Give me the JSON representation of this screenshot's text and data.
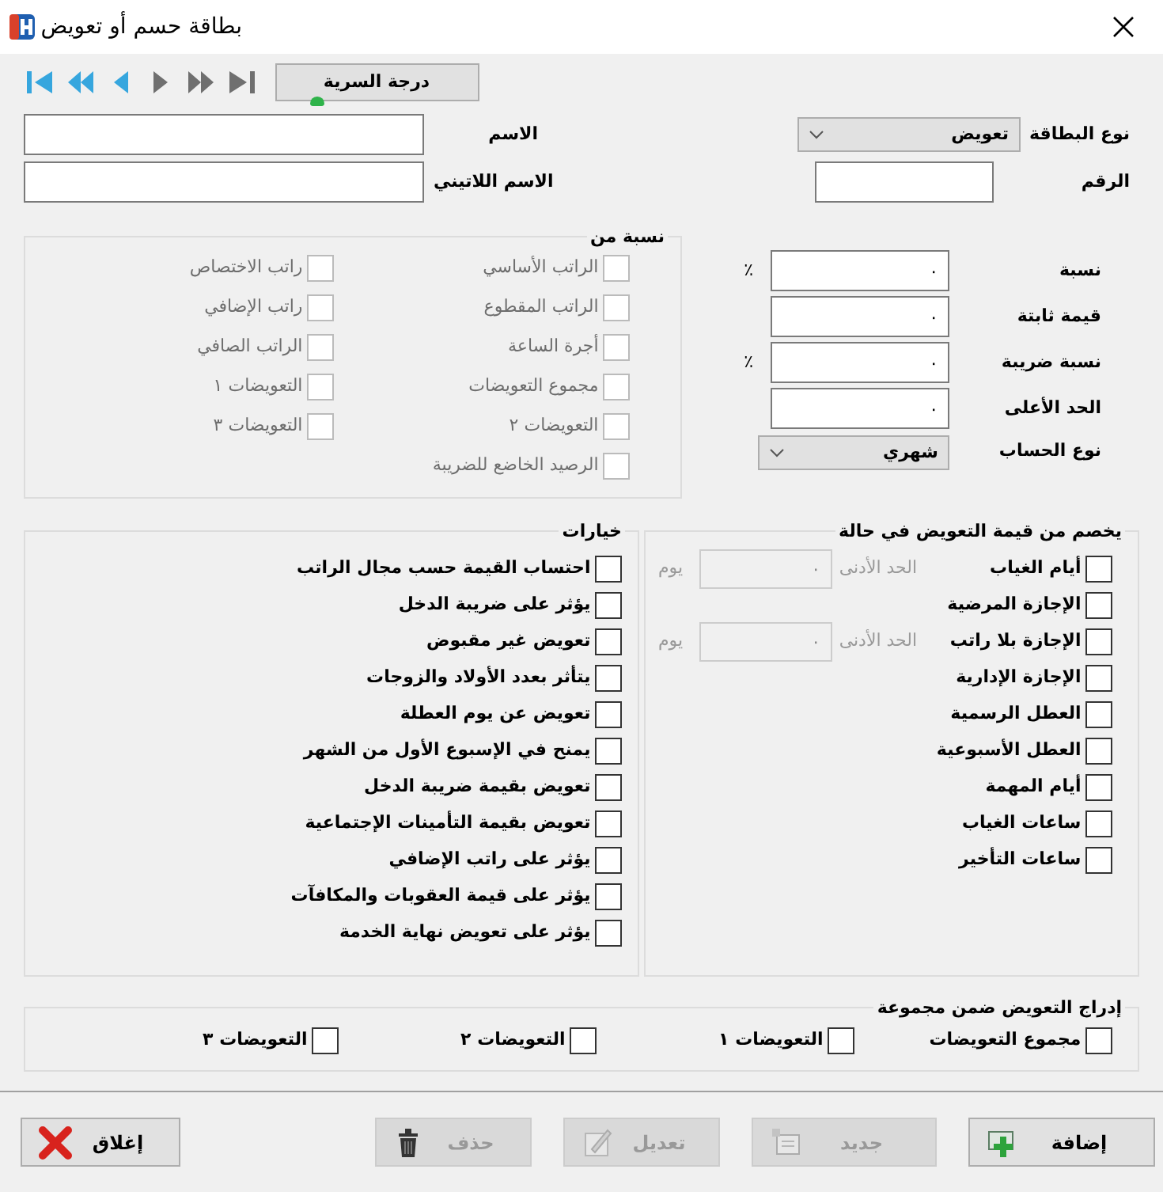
{
  "window": {
    "title": "بطاقة حسم أو تعويض"
  },
  "nav_buttons": [
    {
      "kind": "first",
      "disabled": false
    },
    {
      "kind": "prev-page",
      "disabled": false
    },
    {
      "kind": "prev",
      "disabled": false
    },
    {
      "kind": "next",
      "disabled": true
    },
    {
      "kind": "next-page",
      "disabled": true
    },
    {
      "kind": "last",
      "disabled": true
    }
  ],
  "secrecy_button": {
    "label": "درجة السرية"
  },
  "card_type": {
    "label": "نوع البطاقة",
    "value": "تعويض"
  },
  "number": {
    "label": "الرقم"
  },
  "name": {
    "label": "الاسم"
  },
  "latin_name": {
    "label": "الاسم اللاتيني"
  },
  "amounts": [
    {
      "kind": "field",
      "label": "نسبة",
      "value": "٠",
      "unit": "٪"
    },
    {
      "kind": "field",
      "label": "قيمة ثابتة",
      "value": "٠"
    },
    {
      "kind": "field",
      "label": "نسبة ضريبة",
      "value": "٠",
      "unit": "٪"
    },
    {
      "kind": "field",
      "label": "الحد الأعلى",
      "value": "٠"
    },
    {
      "kind": "select",
      "label": "نوع الحساب",
      "value": "شهري"
    }
  ],
  "percent_of": {
    "title": "نسبة من",
    "columns": [
      [
        {
          "label": "الراتب الأساسي",
          "checked": false,
          "disabled": true
        },
        {
          "label": "الراتب المقطوع",
          "checked": false,
          "disabled": true
        },
        {
          "label": "أجرة الساعة",
          "checked": false,
          "disabled": true
        },
        {
          "label": "مجموع التعويضات",
          "checked": false,
          "disabled": true
        },
        {
          "label": "التعويضات ٢",
          "checked": false,
          "disabled": true
        },
        {
          "label": "الرصيد الخاضع للضريبة",
          "checked": false,
          "disabled": true
        }
      ],
      [
        {
          "label": "راتب الاختصاص",
          "checked": false,
          "disabled": true
        },
        {
          "label": "راتب الإضافي",
          "checked": false,
          "disabled": true
        },
        {
          "label": "الراتب الصافي",
          "checked": false,
          "disabled": true
        },
        {
          "label": "التعويضات ١",
          "checked": false,
          "disabled": true
        },
        {
          "label": "التعويضات ٣",
          "checked": false,
          "disabled": true
        }
      ]
    ]
  },
  "deduct": {
    "title": "يخصم من قيمة التعويض في حالة",
    "items": [
      {
        "label": "أيام الغياب",
        "checked": false,
        "min": {
          "label": "الحد الأدنى",
          "value": "٠",
          "unit": "يوم",
          "disabled": true
        }
      },
      {
        "label": "الإجازة المرضية",
        "checked": false
      },
      {
        "label": "الإجازة بلا راتب",
        "checked": false,
        "min": {
          "label": "الحد الأدنى",
          "value": "٠",
          "unit": "يوم",
          "disabled": true
        }
      },
      {
        "label": "الإجازة الإدارية",
        "checked": false
      },
      {
        "label": "العطل الرسمية",
        "checked": false
      },
      {
        "label": "العطل الأسبوعية",
        "checked": false
      },
      {
        "label": "أيام المهمة",
        "checked": false
      },
      {
        "label": "ساعات الغياب",
        "checked": false
      },
      {
        "label": "ساعات التأخير",
        "checked": false
      }
    ]
  },
  "options": {
    "title": "خيارات",
    "items": [
      {
        "label": "احتساب القيمة حسب مجال الراتب",
        "checked": false
      },
      {
        "label": "يؤثر على ضريبة الدخل",
        "checked": false
      },
      {
        "label": "تعويض غير مقبوض",
        "checked": false
      },
      {
        "label": "يتأثر بعدد الأولاد والزوجات",
        "checked": false
      },
      {
        "label": "تعويض عن يوم العطلة",
        "checked": false
      },
      {
        "label": "يمنح في الإسبوع الأول من الشهر",
        "checked": false
      },
      {
        "label": "تعويض بقيمة ضريبة الدخل",
        "checked": false
      },
      {
        "label": "تعويض بقيمة التأمينات الإجتماعية",
        "checked": false
      },
      {
        "label": "يؤثر على راتب الإضافي",
        "checked": false
      },
      {
        "label": "يؤثر على قيمة العقوبات والمكافآت",
        "checked": false
      },
      {
        "label": "يؤثر على تعويض نهاية الخدمة",
        "checked": false
      }
    ]
  },
  "group": {
    "title": "إدراج التعويض ضمن مجموعة",
    "items": [
      {
        "label": "مجموع التعويضات",
        "checked": false
      },
      {
        "label": "التعويضات ١",
        "checked": false
      },
      {
        "label": "التعويضات ٢",
        "checked": false
      },
      {
        "label": "التعويضات ٣",
        "checked": false
      }
    ]
  },
  "buttons": [
    {
      "kind": "add",
      "label": "إضافة",
      "disabled": false
    },
    {
      "kind": "new",
      "label": "جديد",
      "disabled": true
    },
    {
      "kind": "edit",
      "label": "تعديل",
      "disabled": true
    },
    {
      "kind": "delete",
      "label": "حذف",
      "disabled": true
    },
    {
      "kind": "close",
      "label": "إغلاق",
      "disabled": false
    }
  ]
}
